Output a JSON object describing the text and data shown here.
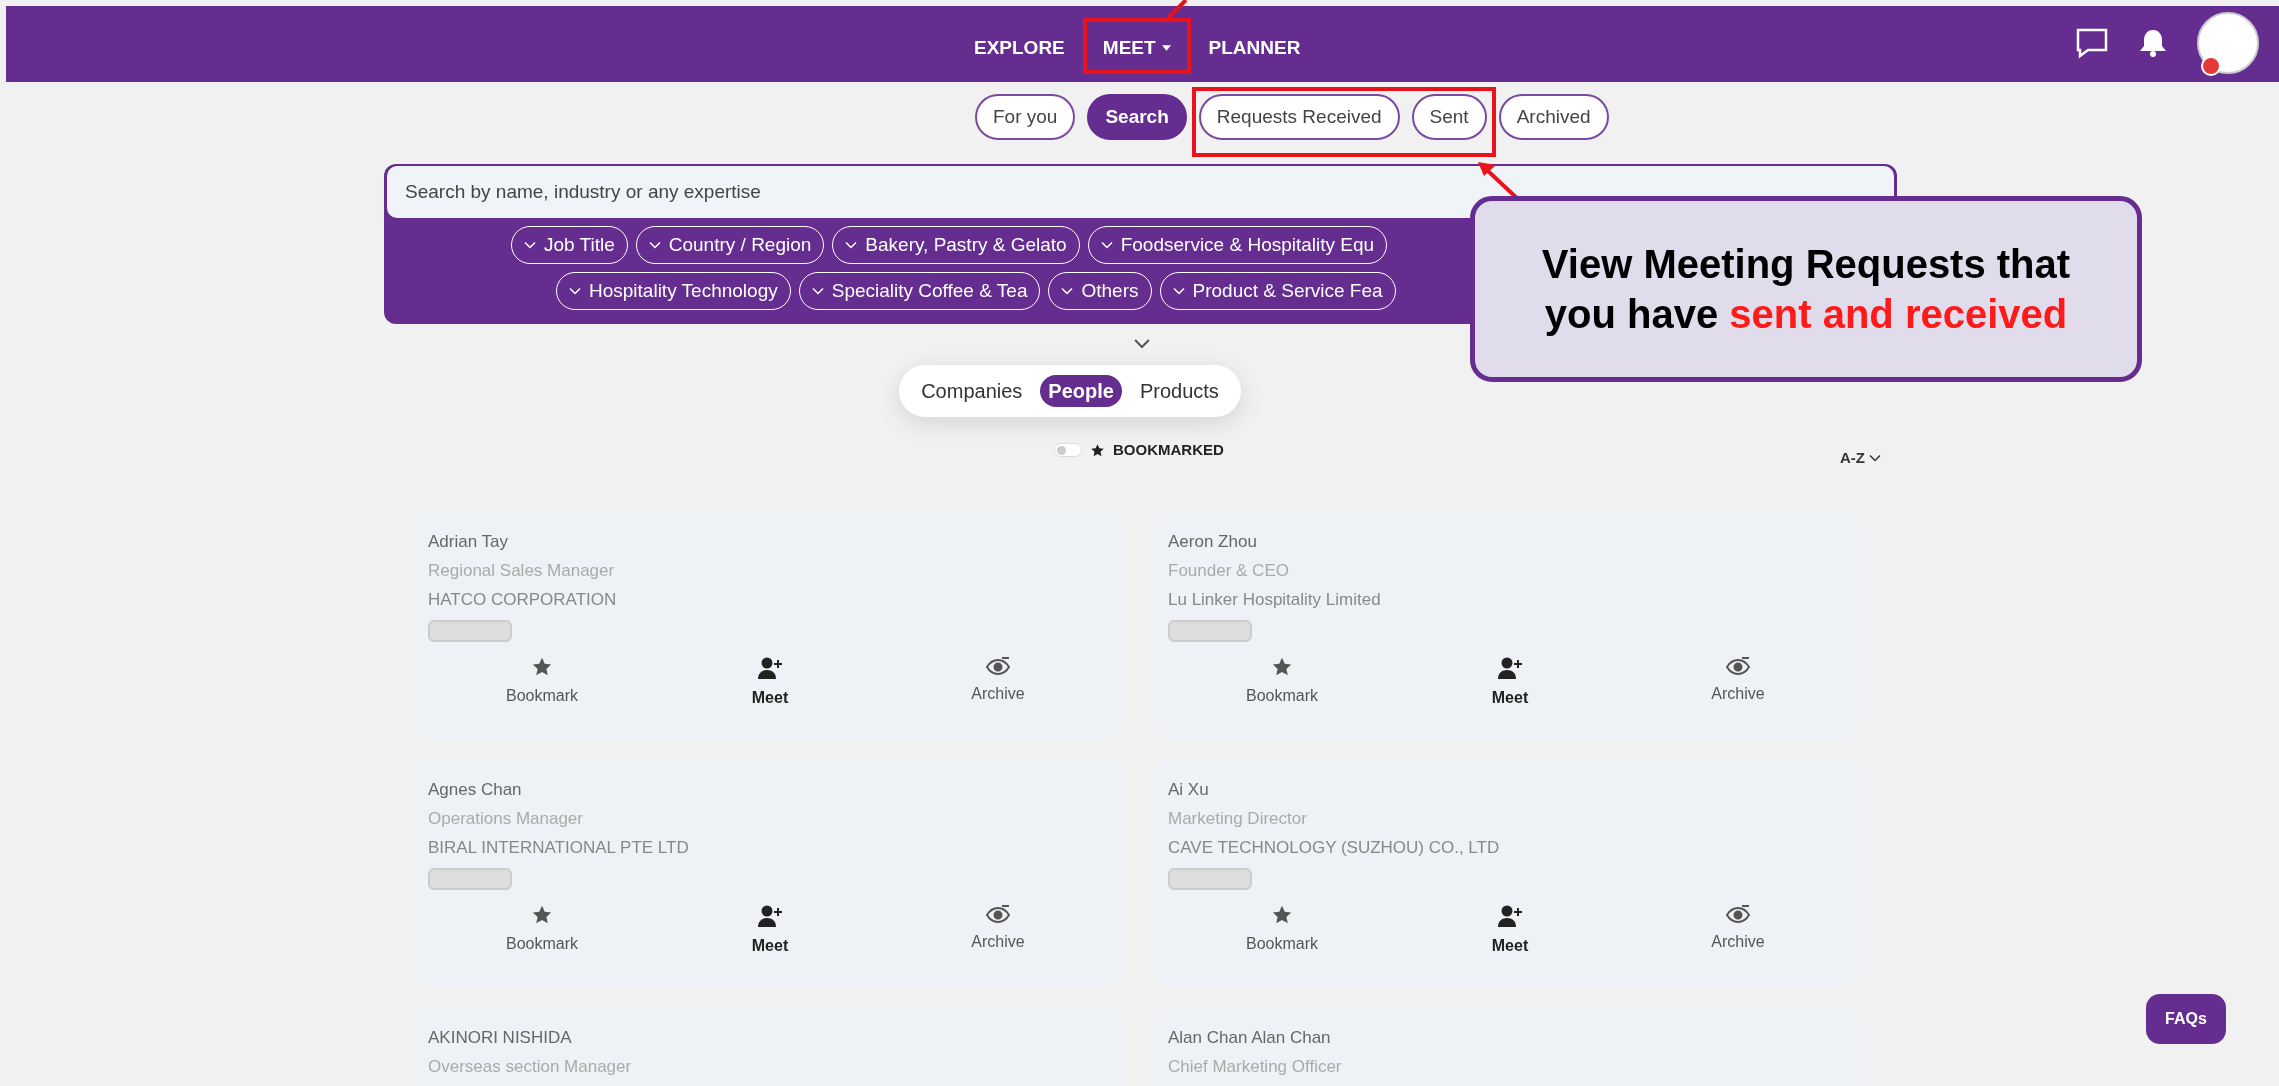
{
  "nav": {
    "items": [
      {
        "label": "EXPLORE",
        "has_menu": false
      },
      {
        "label": "MEET",
        "has_menu": true
      },
      {
        "label": "PLANNER",
        "has_menu": false
      }
    ],
    "notification_dot": true
  },
  "tabs": [
    {
      "label": "For you",
      "selected": false
    },
    {
      "label": "Search",
      "selected": true
    },
    {
      "label": "Requests Received",
      "selected": false
    },
    {
      "label": "Sent",
      "selected": false
    },
    {
      "label": "Archived",
      "selected": false
    }
  ],
  "search": {
    "placeholder": "Search by name, industry or any expertise",
    "filter_rows": [
      [
        "Job Title",
        "Country / Region",
        "Bakery, Pastry & Gelato",
        "Foodservice & Hospitality Equ"
      ],
      [
        "Hospitality Technology",
        "Speciality Coffee & Tea",
        "Others",
        "Product & Service Fea"
      ]
    ]
  },
  "callout": {
    "text": "View Meeting Requests that you have",
    "highlight": "sent and received"
  },
  "segments": [
    {
      "label": "Companies",
      "selected": false
    },
    {
      "label": "People",
      "selected": true
    },
    {
      "label": "Products",
      "selected": false
    }
  ],
  "bookmarked_filter": {
    "label": "BOOKMARKED",
    "on": false
  },
  "sort": "A-Z",
  "cards": [
    {
      "name": "Adrian Tay",
      "title": "Regional Sales Manager",
      "company": "HATCO CORPORATION",
      "actions": [
        {
          "kind": "bookmark",
          "label": "Bookmark"
        },
        {
          "kind": "meet",
          "label": "Meet"
        },
        {
          "kind": "archive",
          "label": "Archive"
        }
      ]
    },
    {
      "name": "Aeron Zhou",
      "title": "Founder & CEO",
      "company": "Lu Linker Hospitality Limited",
      "actions": [
        {
          "kind": "bookmark",
          "label": "Bookmark"
        },
        {
          "kind": "meet",
          "label": "Meet"
        },
        {
          "kind": "archive",
          "label": "Archive"
        }
      ]
    },
    {
      "name": "Agnes Chan",
      "title": "Operations Manager",
      "company": "BIRAL INTERNATIONAL PTE LTD",
      "actions": [
        {
          "kind": "bookmark",
          "label": "Bookmark"
        },
        {
          "kind": "meet",
          "label": "Meet"
        },
        {
          "kind": "archive",
          "label": "Archive"
        }
      ]
    },
    {
      "name": "Ai Xu",
      "title": "Marketing Director",
      "company": "CAVE TECHNOLOGY (SUZHOU) CO., LTD",
      "actions": [
        {
          "kind": "bookmark",
          "label": "Bookmark"
        },
        {
          "kind": "meet",
          "label": "Meet"
        },
        {
          "kind": "archive",
          "label": "Archive"
        }
      ]
    },
    {
      "name": "AKINORI NISHIDA",
      "title": "Overseas section Manager"
    },
    {
      "name": "Alan Chan Alan Chan",
      "title": "Chief Marketing Officer"
    }
  ],
  "faq_button": "FAQs"
}
